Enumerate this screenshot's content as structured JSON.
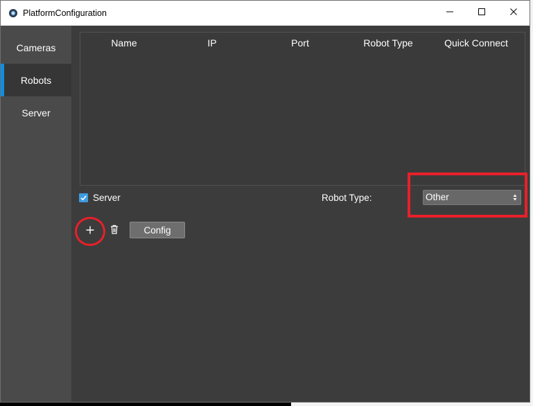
{
  "window": {
    "title": "PlatformConfiguration",
    "controls": {
      "minimize": "minimize-icon",
      "maximize": "maximize-icon",
      "close": "close-icon"
    }
  },
  "sidebar": {
    "items": [
      {
        "label": "Cameras",
        "active": false
      },
      {
        "label": "Robots",
        "active": true
      },
      {
        "label": "Server",
        "active": false
      }
    ],
    "accent_color": "#0f8fe0"
  },
  "table": {
    "columns": [
      "Name",
      "IP",
      "Port",
      "Robot Type",
      "Quick Connect"
    ],
    "rows": []
  },
  "server_checkbox": {
    "label": "Server",
    "checked": true
  },
  "robot_type": {
    "label": "Robot Type:",
    "selected": "Other"
  },
  "toolbar": {
    "add_icon": "plus-icon",
    "delete_icon": "trash-icon",
    "config_label": "Config"
  },
  "annotations": {
    "color": "#e8202a"
  }
}
